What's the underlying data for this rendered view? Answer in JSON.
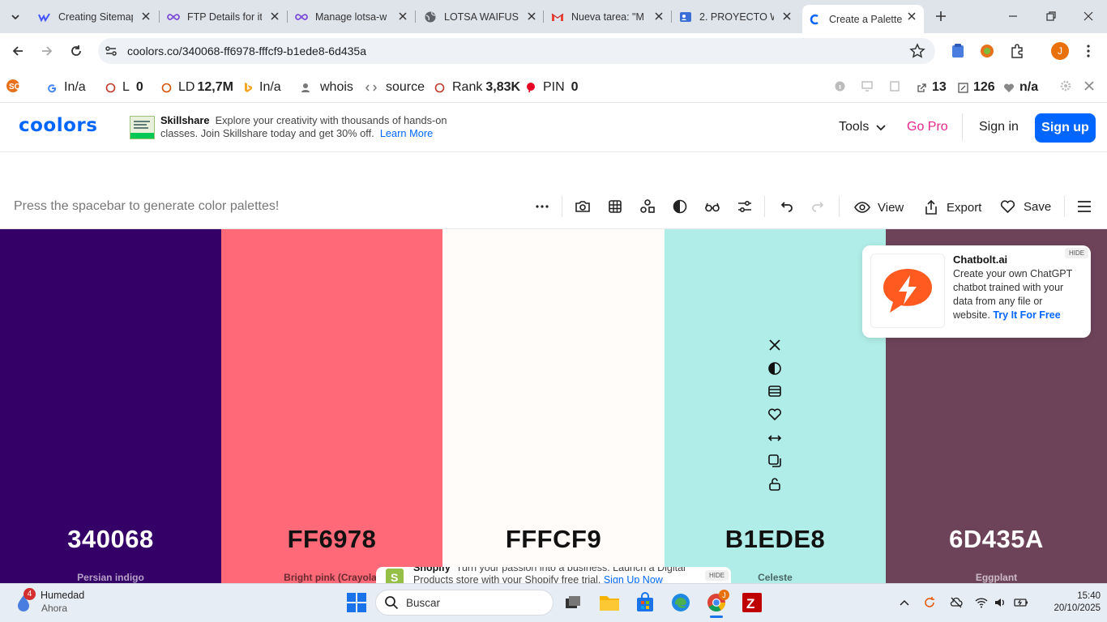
{
  "browser": {
    "tabs": [
      {
        "title": "Creating Sitemap",
        "icon": "webflow-icon"
      },
      {
        "title": "FTP Details for it",
        "icon": "infinity-icon"
      },
      {
        "title": "Manage lotsa-w",
        "icon": "infinity-icon"
      },
      {
        "title": "LOTSA WAIFUS|2",
        "icon": "globe-icon"
      },
      {
        "title": "Nueva tarea: \"M",
        "icon": "gmail-icon"
      },
      {
        "title": "2. PROYECTO W",
        "icon": "contact-icon"
      },
      {
        "title": "Create a Palette",
        "icon": "coolors-icon",
        "active": true
      }
    ],
    "url": "coolors.co/340068-ff6978-fffcf9-b1ede8-6d435a",
    "profile_initial": "J"
  },
  "seo_bar": {
    "google": {
      "prefix": "I",
      "value": "n/a"
    },
    "links": {
      "prefix": "L",
      "value": "0"
    },
    "ld": {
      "prefix": "LD",
      "value": "12,7M"
    },
    "bing": {
      "prefix": "I",
      "value": "n/a"
    },
    "whois": "whois",
    "source": "source",
    "rank": {
      "prefix": "Rank",
      "value": "3,83K"
    },
    "pin": {
      "prefix": "PIN",
      "value": "0"
    },
    "ext_links": "13",
    "pages": "126",
    "health": "n/a"
  },
  "header": {
    "logo": "coolors",
    "ad": {
      "brand": "Skillshare",
      "text": "Explore your creativity with thousands of hands-on classes. Join Skillshare today and get 30% off.",
      "cta": "Learn More"
    },
    "nav": {
      "tools": "Tools",
      "gopro": "Go Pro",
      "signin": "Sign in",
      "signup": "Sign up"
    }
  },
  "toolbar": {
    "hint": "Press the spacebar to generate color palettes!",
    "view": "View",
    "export": "Export",
    "save": "Save"
  },
  "palette": [
    {
      "hex": "340068",
      "name": "Persian indigo",
      "color": "#340068",
      "text": "#ffffff",
      "name_color": "#b7a3c9"
    },
    {
      "hex": "FF6978",
      "name": "Bright pink (Crayola)",
      "color": "#ff6978",
      "text": "#111111",
      "name_color": "#6a2a31"
    },
    {
      "hex": "FFFCF9",
      "name": "Isabelline",
      "color": "#fffcf9",
      "text": "#111111",
      "name_color": "#777777"
    },
    {
      "hex": "B1EDE8",
      "name": "Celeste",
      "color": "#b1ede8",
      "text": "#111111",
      "name_color": "#4a6664"
    },
    {
      "hex": "6D435A",
      "name": "Eggplant",
      "color": "#6d435a",
      "text": "#ffffff",
      "name_color": "#cdbcc5"
    }
  ],
  "chat_ad": {
    "title": "Chatbolt.ai",
    "body": "Create your own ChatGPT chatbot trained with your data from any file or website.",
    "cta": "Try It For Free",
    "hide": "HIDE"
  },
  "shop_ad": {
    "brand": "Shopify",
    "text": "Turn your passion into a business. Launch a Digital Products store with your Shopify free trial.",
    "cta": "Sign Up Now",
    "hide": "HIDE"
  },
  "taskbar": {
    "weather_badge": "4",
    "weather_title": "Humedad",
    "weather_sub": "Ahora",
    "search": "Buscar",
    "chrome_badge": "J",
    "time": "15:40",
    "date": "20/10/2025"
  }
}
